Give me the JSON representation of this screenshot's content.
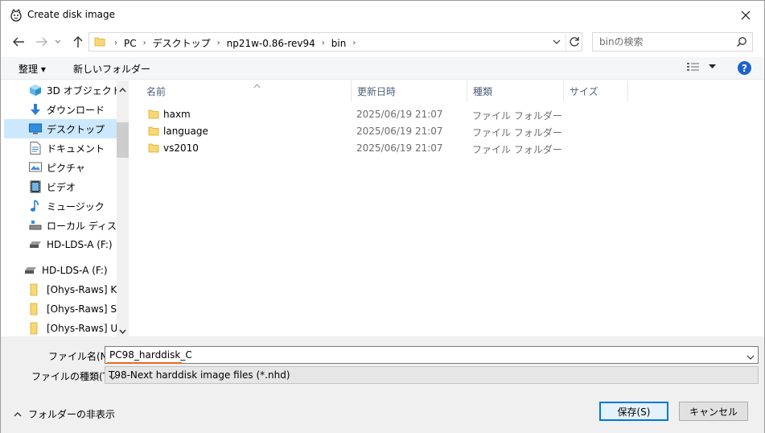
{
  "window": {
    "title": "Create disk image"
  },
  "address": {
    "crumbs": [
      "PC",
      "デスクトップ",
      "np21w-0.86-rev94",
      "bin"
    ]
  },
  "search": {
    "placeholder": "binの検索"
  },
  "toolbar": {
    "organize_label": "整理 ▾",
    "new_folder_label": "新しいフォルダー"
  },
  "nav": {
    "items": [
      {
        "label": "3D オブジェクト",
        "icon": "3d-objects-icon"
      },
      {
        "label": "ダウンロード",
        "icon": "download-icon"
      },
      {
        "label": "デスクトップ",
        "icon": "desktop-icon",
        "selected": true
      },
      {
        "label": "ドキュメント",
        "icon": "document-icon"
      },
      {
        "label": "ピクチャ",
        "icon": "pictures-icon"
      },
      {
        "label": "ビデオ",
        "icon": "video-icon"
      },
      {
        "label": "ミュージック",
        "icon": "music-icon"
      },
      {
        "label": "ローカル ディスク (C",
        "icon": "local-disk-icon"
      },
      {
        "label": "HD-LDS-A (F:)",
        "icon": "drive-icon"
      },
      {
        "label": "HD-LDS-A (F:)",
        "icon": "drive-icon"
      },
      {
        "label": "[Ohys-Raws] Ker",
        "icon": "folder-icon"
      },
      {
        "label": "[Ohys-Raws] Shi",
        "icon": "folder-icon"
      },
      {
        "label": "[Ohys-Raws] Ucl",
        "icon": "folder-icon"
      }
    ]
  },
  "filelist": {
    "columns": [
      "名前",
      "更新日時",
      "種類",
      "サイズ"
    ],
    "rows": [
      {
        "name": "haxm",
        "date": "2025/06/19 21:07",
        "type": "ファイル フォルダー"
      },
      {
        "name": "language",
        "date": "2025/06/19 21:07",
        "type": "ファイル フォルダー"
      },
      {
        "name": "vs2010",
        "date": "2025/06/19 21:07",
        "type": "ファイル フォルダー"
      }
    ]
  },
  "form": {
    "filename_label": "ファイル名(N):",
    "filename_value": "PC98_harddisk_C",
    "filetype_label": "ファイルの種類(T):",
    "filetype_value": "T98-Next harddisk image files (*.nhd)"
  },
  "footer": {
    "hide_folders_label": "フォルダーの非表示",
    "save_label": "保存(S)",
    "cancel_label": "キャンセル"
  },
  "colors": {
    "accent": "#0078d7",
    "selection": "#cce8ff",
    "folder": "#f8d775"
  }
}
